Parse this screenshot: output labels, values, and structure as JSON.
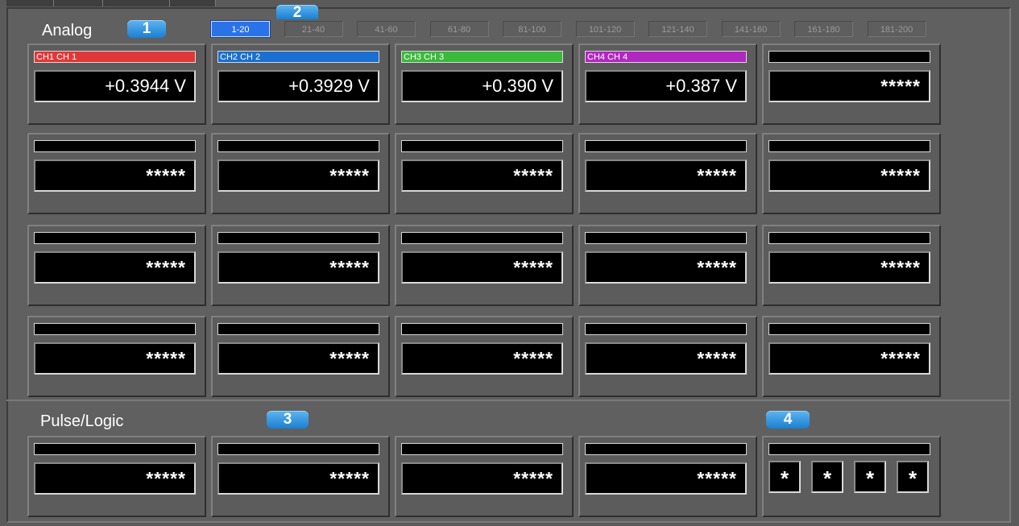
{
  "analog": {
    "title": "Analog",
    "badge": "1",
    "pages_badge": "2",
    "pages": [
      "1-20",
      "21-40",
      "41-60",
      "61-80",
      "81-100",
      "101-120",
      "121-140",
      "141-160",
      "161-180",
      "181-200"
    ],
    "active_page": "1-20",
    "channels": [
      {
        "label": "CH1  CH 1",
        "value": "+0.3944 V",
        "color": "#e03838"
      },
      {
        "label": "CH2  CH 2",
        "value": "+0.3929 V",
        "color": "#1a6fd0"
      },
      {
        "label": "CH3  CH 3",
        "value": "+0.390 V",
        "color": "#3cb83c"
      },
      {
        "label": "CH4  CH 4",
        "value": "+0.387 V",
        "color": "#b028c0"
      },
      {
        "label": "",
        "value": "*****",
        "color": "#000000"
      },
      {
        "label": "",
        "value": "*****",
        "color": "#000000"
      },
      {
        "label": "",
        "value": "*****",
        "color": "#000000"
      },
      {
        "label": "",
        "value": "*****",
        "color": "#000000"
      },
      {
        "label": "",
        "value": "*****",
        "color": "#000000"
      },
      {
        "label": "",
        "value": "*****",
        "color": "#000000"
      },
      {
        "label": "",
        "value": "*****",
        "color": "#000000"
      },
      {
        "label": "",
        "value": "*****",
        "color": "#000000"
      },
      {
        "label": "",
        "value": "*****",
        "color": "#000000"
      },
      {
        "label": "",
        "value": "*****",
        "color": "#000000"
      },
      {
        "label": "",
        "value": "*****",
        "color": "#000000"
      },
      {
        "label": "",
        "value": "*****",
        "color": "#000000"
      },
      {
        "label": "",
        "value": "*****",
        "color": "#000000"
      },
      {
        "label": "",
        "value": "*****",
        "color": "#000000"
      },
      {
        "label": "",
        "value": "*****",
        "color": "#000000"
      },
      {
        "label": "",
        "value": "*****",
        "color": "#000000"
      }
    ]
  },
  "pulse": {
    "title": "Pulse/Logic",
    "badge": "3",
    "logic_badge": "4",
    "channels": [
      {
        "label": "",
        "value": "*****"
      },
      {
        "label": "",
        "value": "*****"
      },
      {
        "label": "",
        "value": "*****"
      },
      {
        "label": "",
        "value": "*****"
      }
    ],
    "logic": {
      "label": "",
      "digits": [
        "*",
        "*",
        "*",
        "*"
      ]
    }
  }
}
